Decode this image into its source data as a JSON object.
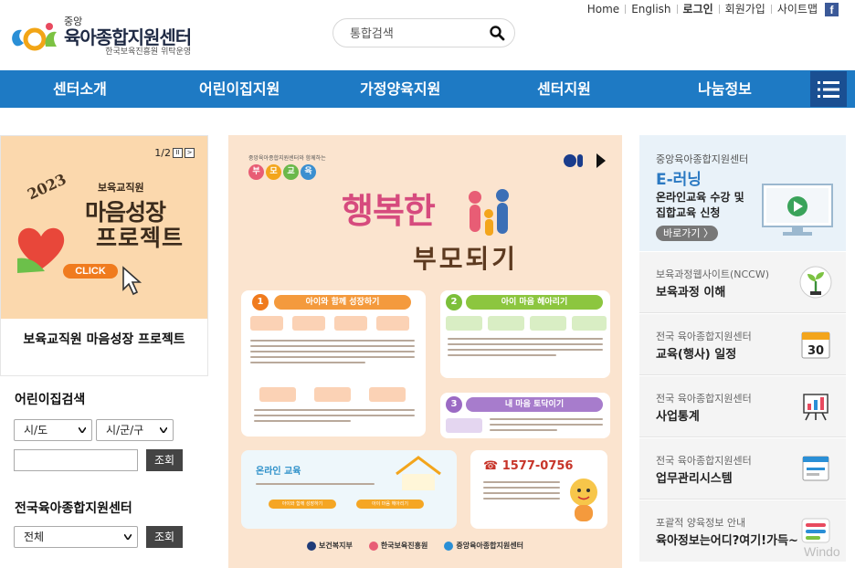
{
  "header": {
    "logo_small": "중앙",
    "logo_main": "육아종합지원센터",
    "logo_sub": "한국보육진흥원 위탁운영",
    "search_placeholder": "통합검색",
    "top_links": [
      "Home",
      "English",
      "로그인",
      "회원가입",
      "사이트맵"
    ],
    "facebook_letter": "f"
  },
  "nav": {
    "items": [
      "센터소개",
      "어린이집지원",
      "가정양육지원",
      "센터지원",
      "나눔정보"
    ]
  },
  "promo": {
    "counter": "1/2",
    "year": "2023",
    "line1": "보육교직원",
    "line2": "마음성장",
    "line3": "프로젝트",
    "click": "CLICK",
    "caption": "보육교직원 마음성장 프로젝트"
  },
  "finder": {
    "daycare_title": "어린이집검색",
    "sido": "시/도",
    "sigungu": "시/군/구",
    "search_btn": "조회",
    "center_title": "전국육아종합지원센터",
    "all": "전체",
    "search_btn2": "조회"
  },
  "poster": {
    "org": "중앙육아종합지원센터와 함께하는",
    "badge": [
      "부",
      "모",
      "교",
      "육"
    ],
    "title1": "행복한",
    "title2": "부모되기",
    "section1": "아이와 함께 성장하기",
    "section2": "아이 마음 헤아리기",
    "section3": "내 마음 토닥이기",
    "online": "온라인 교육",
    "phone": "☎ 1577-0756",
    "online_btn1": "아이와 함께 성장하기",
    "online_btn2": "아이 마음 헤아리기",
    "logos": [
      "보건복지부",
      "한국보육진흥원",
      "중앙육아종합지원센터"
    ]
  },
  "right": {
    "elearn_small": "중앙육아종합지원센터",
    "elearn_big": "E-러닝",
    "elearn_desc": "온라인교육 수강 및 집합교육 신청",
    "elearn_btn": "바로가기 〉",
    "boxes": [
      {
        "small": "보육과정웹사이트(NCCW)",
        "big": "보육과정 이해"
      },
      {
        "small": "전국 육아종합지원센터",
        "big": "교육(행사) 일정"
      },
      {
        "small": "전국 육아종합지원센터",
        "big": "사업통계"
      },
      {
        "small": "전국 육아종합지원센터",
        "big": "업무관리시스템"
      },
      {
        "small": "포괄적 양육정보 안내",
        "big": "육아정보는어디?여기!가득~"
      }
    ],
    "calendar_num": "30"
  },
  "watermark": "Windo",
  "colors": {
    "nav": "#1e7ac4",
    "menu_btn": "#1a4f92",
    "elearn_bg": "#e9f2f9",
    "poster_bg": "#fbe4cf"
  }
}
